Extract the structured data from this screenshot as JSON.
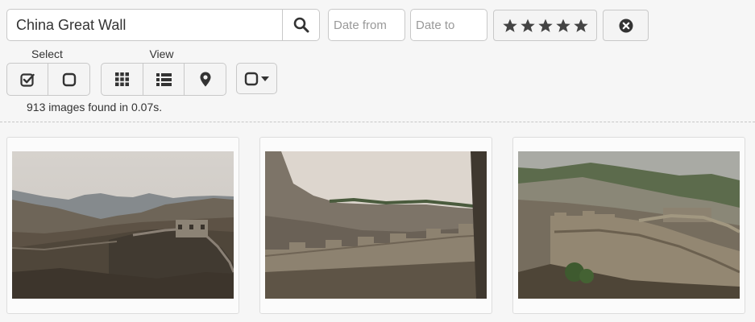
{
  "search": {
    "value": "China Great Wall",
    "icon": "search-icon"
  },
  "filters": {
    "date_from_placeholder": "Date from",
    "date_to_placeholder": "Date to",
    "rating_stars": 5,
    "reset_icon": "circle-x-icon"
  },
  "toolbar": {
    "select_label": "Select",
    "view_label": "View",
    "select_buttons": [
      "check-all-icon",
      "uncheck-icon"
    ],
    "view_buttons": [
      "grid-icon",
      "list-icon",
      "map-marker-icon"
    ],
    "selection_dropdown_icon": "square-caret-icon"
  },
  "results": {
    "summary": "913 images found in 0.07s."
  },
  "images": [
    {
      "name": "great-wall-valley"
    },
    {
      "name": "great-wall-battlements"
    },
    {
      "name": "great-wall-winding"
    }
  ]
}
